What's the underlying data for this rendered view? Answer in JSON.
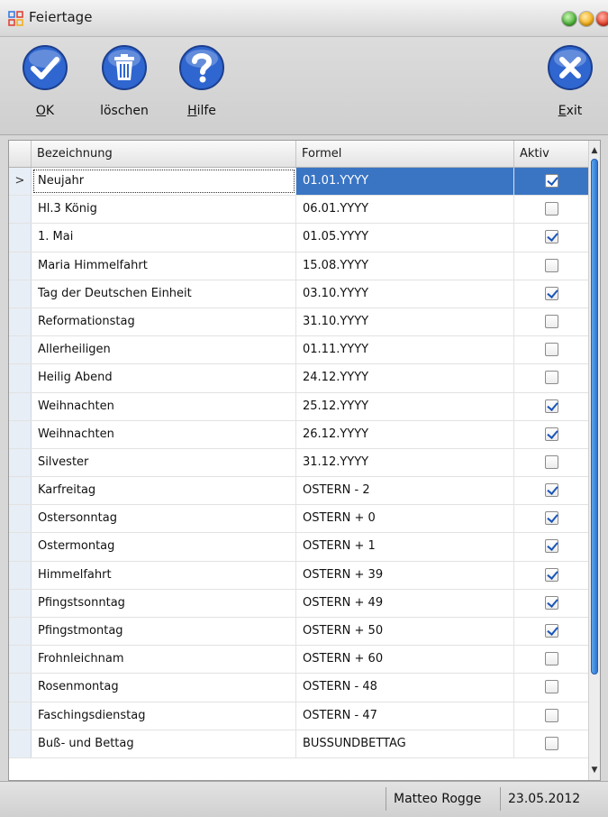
{
  "window": {
    "title": "Feiertage"
  },
  "toolbar": {
    "ok": {
      "label_u": "O",
      "label_rest": "K"
    },
    "delete": {
      "label": "löschen"
    },
    "help": {
      "label_u": "H",
      "label_rest": "ilfe"
    },
    "exit": {
      "label_u": "E",
      "label_rest": "xit"
    }
  },
  "grid": {
    "columns": [
      "Bezeichnung",
      "Formel",
      "Aktiv"
    ],
    "current_row_marker": ">",
    "rows": [
      {
        "name": "Neujahr",
        "formula": "01.01.YYYY",
        "active": true,
        "selected": true
      },
      {
        "name": "Hl.3 König",
        "formula": "06.01.YYYY",
        "active": false
      },
      {
        "name": "1. Mai",
        "formula": "01.05.YYYY",
        "active": true
      },
      {
        "name": "Maria Himmelfahrt",
        "formula": "15.08.YYYY",
        "active": false
      },
      {
        "name": "Tag der Deutschen Einheit",
        "formula": "03.10.YYYY",
        "active": true
      },
      {
        "name": "Reformationstag",
        "formula": "31.10.YYYY",
        "active": false
      },
      {
        "name": "Allerheiligen",
        "formula": "01.11.YYYY",
        "active": false
      },
      {
        "name": "Heilig Abend",
        "formula": "24.12.YYYY",
        "active": false
      },
      {
        "name": "Weihnachten",
        "formula": "25.12.YYYY",
        "active": true
      },
      {
        "name": "Weihnachten",
        "formula": "26.12.YYYY",
        "active": true
      },
      {
        "name": "Silvester",
        "formula": "31.12.YYYY",
        "active": false
      },
      {
        "name": "Karfreitag",
        "formula": "OSTERN - 2",
        "active": true
      },
      {
        "name": "Ostersonntag",
        "formula": "OSTERN + 0",
        "active": true
      },
      {
        "name": "Ostermontag",
        "formula": "OSTERN + 1",
        "active": true
      },
      {
        "name": "Himmelfahrt",
        "formula": "OSTERN + 39",
        "active": true
      },
      {
        "name": "Pfingstsonntag",
        "formula": "OSTERN + 49",
        "active": true
      },
      {
        "name": "Pfingstmontag",
        "formula": "OSTERN + 50",
        "active": true
      },
      {
        "name": "Frohnleichnam",
        "formula": "OSTERN + 60",
        "active": false
      },
      {
        "name": "Rosenmontag",
        "formula": "OSTERN - 48",
        "active": false
      },
      {
        "name": "Faschingsdienstag",
        "formula": "OSTERN - 47",
        "active": false
      },
      {
        "name": "Buß- und Bettag",
        "formula": "BUSSUNDBETTAG",
        "active": false
      }
    ]
  },
  "statusbar": {
    "user": "Matteo Rogge",
    "date": "23.05.2012"
  },
  "colors": {
    "accent": "#3a75c4",
    "icon_blue": "#2b5cc4"
  }
}
